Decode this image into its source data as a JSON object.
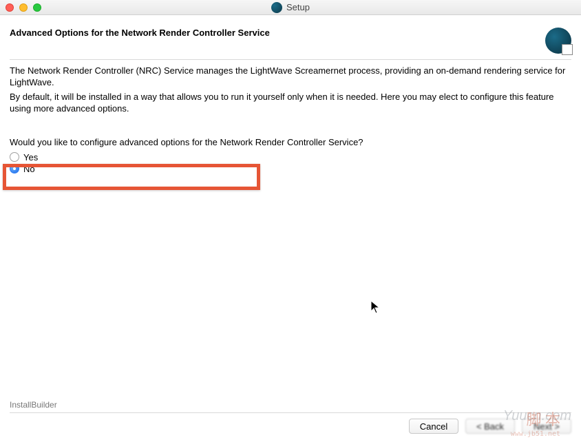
{
  "window": {
    "title": "Setup"
  },
  "header": {
    "heading": "Advanced Options for the Network Render Controller Service"
  },
  "body": {
    "paragraph1": "The Network Render Controller (NRC) Service manages the LightWave Screamernet process, providing an on-demand rendering service for LightWave.",
    "paragraph2": "By default, it will be installed in a way that allows you to run it yourself only when it is needed.  Here you may elect to configure this feature using more advanced options."
  },
  "question": {
    "prompt": "Would you like to configure advanced options for the Network Render Controller Service?",
    "options": {
      "yes": "Yes",
      "no": "No"
    },
    "selected": "no"
  },
  "footer": {
    "brand": "InstallBuilder",
    "buttons": {
      "cancel": "Cancel",
      "back": "< Back",
      "next": "Next >"
    }
  },
  "watermarks": {
    "a_main": "脚 本",
    "a_sub": "www.jb51.net",
    "b": "Yuucn.com"
  }
}
